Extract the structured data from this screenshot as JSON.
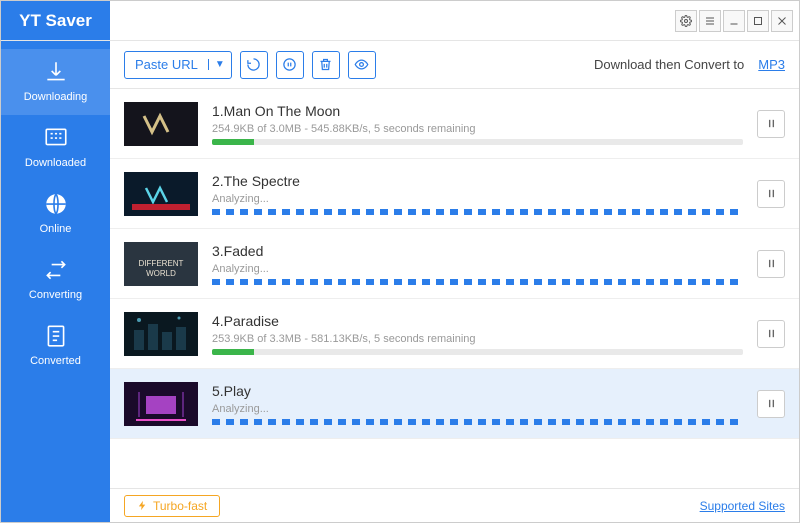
{
  "app": {
    "title": "YT Saver"
  },
  "sidebar": {
    "items": [
      {
        "label": "Downloading"
      },
      {
        "label": "Downloaded"
      },
      {
        "label": "Online"
      },
      {
        "label": "Converting"
      },
      {
        "label": "Converted"
      }
    ]
  },
  "toolbar": {
    "paste_label": "Paste URL",
    "convert_prefix": "Download then Convert to",
    "convert_format": "MP3"
  },
  "downloads": [
    {
      "title": "1.Man On The Moon",
      "status": "254.9KB of 3.0MB - 545.88KB/s, 5 seconds remaining",
      "progress": 8,
      "analyzing": false,
      "selected": false
    },
    {
      "title": "2.The Spectre",
      "status": "Analyzing...",
      "progress": 0,
      "analyzing": true,
      "selected": false
    },
    {
      "title": "3.Faded",
      "status": "Analyzing...",
      "progress": 0,
      "analyzing": true,
      "selected": false
    },
    {
      "title": "4.Paradise",
      "status": "253.9KB of 3.3MB - 581.13KB/s, 5 seconds remaining",
      "progress": 8,
      "analyzing": false,
      "selected": false
    },
    {
      "title": "5.Play",
      "status": "Analyzing...",
      "progress": 0,
      "analyzing": true,
      "selected": true
    }
  ],
  "footer": {
    "turbo_label": "Turbo-fast",
    "sites_label": "Supported Sites"
  }
}
